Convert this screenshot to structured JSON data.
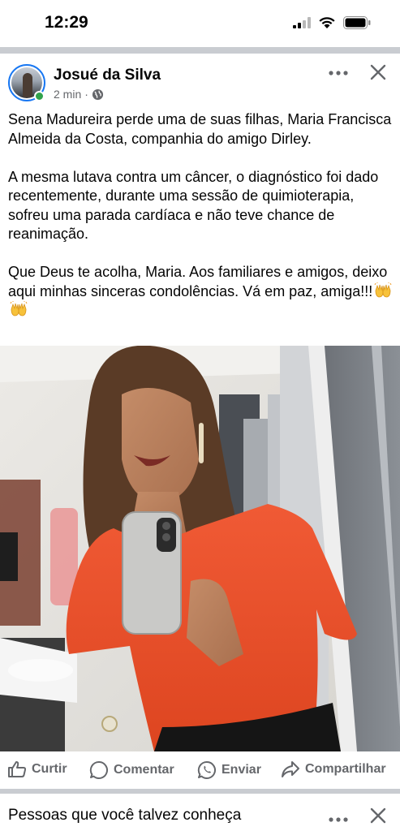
{
  "status_bar": {
    "time": "12:29",
    "icons": [
      "cellular-signal-icon",
      "wifi-icon",
      "battery-icon"
    ]
  },
  "post": {
    "author": "Josué da Silva",
    "time_ago": "2 min",
    "meta_separator": "·",
    "privacy_icon": "globe-icon",
    "paragraphs": [
      "Sena Madureira perde uma de suas filhas, Maria Francisca Almeida da Costa, companhia do amigo Dirley.",
      "A mesma lutava contra um câncer, o diagnóstico foi dado recentemente, durante uma sessão de quimioterapia, sofreu uma parada cardíaca e não teve chance de reanimação.",
      "Que Deus te acolha, Maria. Aos familiares e amigos, deixo aqui minhas sinceras condolências. Vá em paz, amiga!!!"
    ],
    "emojis": [
      "raising-hands-emoji",
      "raising-hands-emoji"
    ],
    "photo": "selfie-photo"
  },
  "actions": {
    "like": "Curtir",
    "comment": "Comentar",
    "send": "Enviar",
    "share": "Compartilhar"
  },
  "suggestions": {
    "title": "Pessoas que você talvez conheça"
  },
  "colors": {
    "accent": "#1877f2",
    "online": "#31a24c",
    "secondary_text": "#65676b",
    "separator": "#c9ccd1",
    "shirt": "#e8502d"
  }
}
